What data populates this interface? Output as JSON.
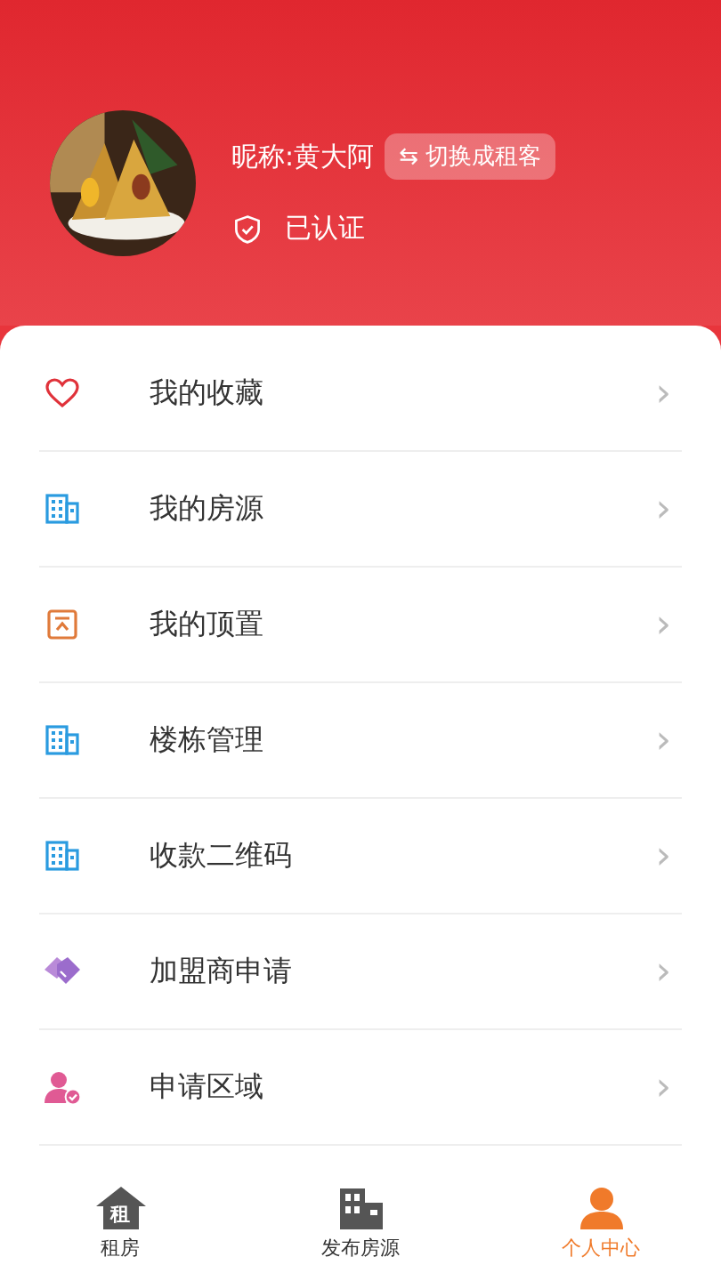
{
  "profile": {
    "nickname": "昵称:黄大阿",
    "switch_button": "⇆ 切换成租客",
    "verified": true,
    "verified_label": "已认证"
  },
  "menu": [
    {
      "label": "我的收藏",
      "kind": "heart",
      "chevron": "›"
    },
    {
      "label": "我的房源",
      "kind": "building",
      "chevron": "›"
    },
    {
      "label": "我的顶置",
      "kind": "pin",
      "chevron": "›"
    },
    {
      "label": "楼栋管理",
      "kind": "building",
      "chevron": "›"
    },
    {
      "label": "收款二维码",
      "kind": "building",
      "chevron": "›"
    },
    {
      "label": "加盟商申请",
      "kind": "handshake",
      "chevron": "›"
    },
    {
      "label": "申请区域",
      "kind": "person",
      "chevron": "›"
    }
  ],
  "tabs": [
    {
      "label": "租房",
      "kind": "house",
      "icon_text": "租",
      "selected": false
    },
    {
      "label": "发布房源",
      "kind": "building",
      "selected": false
    },
    {
      "label": "个人中心",
      "kind": "person",
      "selected": true
    }
  ]
}
